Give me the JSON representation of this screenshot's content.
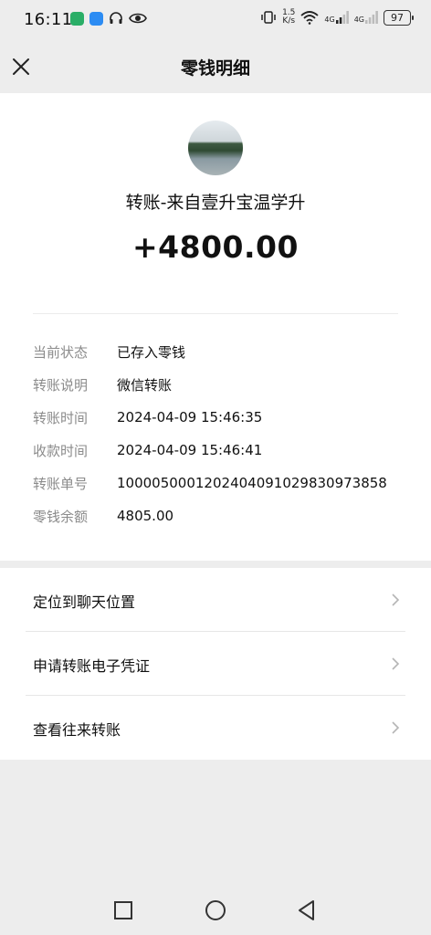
{
  "status_bar": {
    "time": "16:11",
    "left_icons": [
      "wechat-icon",
      "app-icon",
      "headphones-icon",
      "eye-icon"
    ],
    "net_speed_value": "1.5",
    "net_speed_unit": "K/s",
    "signal1": "4G",
    "signal2": "4G",
    "battery": "97"
  },
  "header": {
    "title": "零钱明细"
  },
  "transfer": {
    "source": "转账-来自壹升宝温学升",
    "amount": "+4800.00"
  },
  "details": [
    {
      "label": "当前状态",
      "value": "已存入零钱"
    },
    {
      "label": "转账说明",
      "value": "微信转账"
    },
    {
      "label": "转账时间",
      "value": "2024-04-09 15:46:35"
    },
    {
      "label": "收款时间",
      "value": "2024-04-09 15:46:41"
    },
    {
      "label": "转账单号",
      "value": "1000050001202404091029830973858"
    },
    {
      "label": "零钱余额",
      "value": "4805.00"
    }
  ],
  "actions": [
    {
      "label": "定位到聊天位置"
    },
    {
      "label": "申请转账电子凭证"
    },
    {
      "label": "查看往来转账"
    }
  ],
  "colors": {
    "background": "#ededed",
    "card": "#ffffff",
    "label": "#8b8b8b",
    "text": "#111111"
  }
}
